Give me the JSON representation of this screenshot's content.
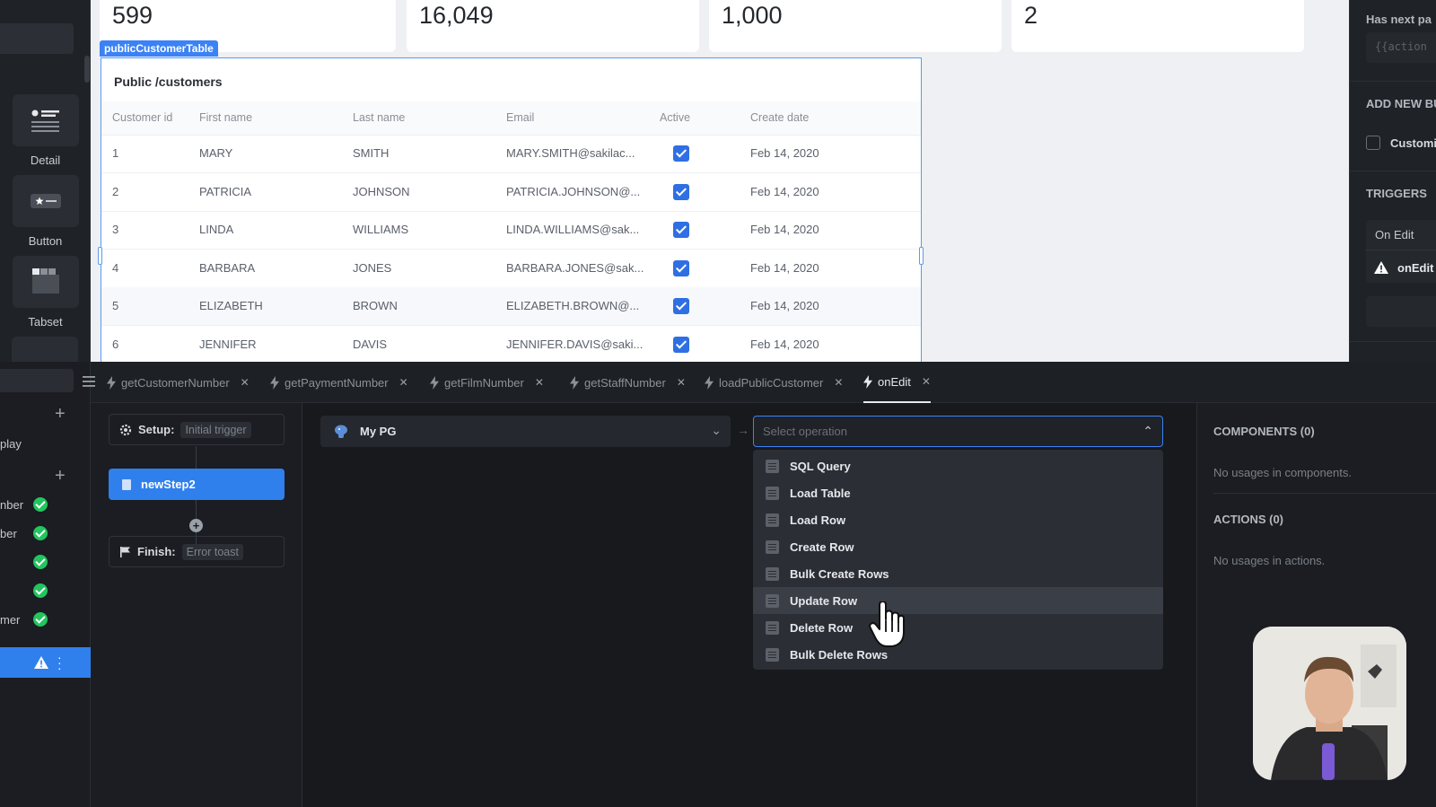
{
  "left_palette": {
    "components": [
      {
        "label": "Detail",
        "icon": "detail-icon"
      },
      {
        "label": "Button",
        "icon": "button-icon"
      },
      {
        "label": "Tabset",
        "icon": "tabset-icon"
      }
    ]
  },
  "stats": [
    "599",
    "16,049",
    "1,000",
    "2"
  ],
  "table": {
    "tag": "publicCustomerTable",
    "title": "Public /customers",
    "columns": [
      "Customer id",
      "First name",
      "Last name",
      "Email",
      "Active",
      "Create date"
    ],
    "rows": [
      {
        "id": "1",
        "first": "MARY",
        "last": "SMITH",
        "email": "MARY.SMITH@sakilac...",
        "active": true,
        "date": "Feb 14, 2020"
      },
      {
        "id": "2",
        "first": "PATRICIA",
        "last": "JOHNSON",
        "email": "PATRICIA.JOHNSON@...",
        "active": true,
        "date": "Feb 14, 2020"
      },
      {
        "id": "3",
        "first": "LINDA",
        "last": "WILLIAMS",
        "email": "LINDA.WILLIAMS@sak...",
        "active": true,
        "date": "Feb 14, 2020"
      },
      {
        "id": "4",
        "first": "BARBARA",
        "last": "JONES",
        "email": "BARBARA.JONES@sak...",
        "active": true,
        "date": "Feb 14, 2020"
      },
      {
        "id": "5",
        "first": "ELIZABETH",
        "last": "BROWN",
        "email": "ELIZABETH.BROWN@...",
        "active": true,
        "date": "Feb 14, 2020"
      },
      {
        "id": "6",
        "first": "JENNIFER",
        "last": "DAVIS",
        "email": "JENNIFER.DAVIS@saki...",
        "active": true,
        "date": "Feb 14, 2020"
      }
    ]
  },
  "inspector": {
    "has_next_page_label": "Has next pa",
    "has_next_page_value": "{{action",
    "add_new_label": "ADD NEW BU",
    "custom_label": "Customi",
    "triggers_label": "TRIGGERS",
    "on_edit_label": "On Edit",
    "on_edit_handler": "onEdit"
  },
  "query_sidebar": {
    "section_label": "play",
    "queries": [
      {
        "label": "nber",
        "status": "ok"
      },
      {
        "label": "ber",
        "status": "ok"
      },
      {
        "label": "",
        "status": "ok"
      },
      {
        "label": "",
        "status": "ok"
      },
      {
        "label": "mer",
        "status": "ok"
      }
    ]
  },
  "tabs": [
    {
      "label": "getCustomerNumber",
      "active": false
    },
    {
      "label": "getPaymentNumber",
      "active": false
    },
    {
      "label": "getFilmNumber",
      "active": false
    },
    {
      "label": "getStaffNumber",
      "active": false
    },
    {
      "label": "loadPublicCustomer",
      "active": false
    },
    {
      "label": "onEdit",
      "active": true
    }
  ],
  "flow": {
    "setup_label": "Setup:",
    "setup_value": "Initial trigger",
    "step_label": "newStep2",
    "finish_label": "Finish:",
    "finish_value": "Error toast"
  },
  "editor": {
    "datasource": "My PG",
    "operation_placeholder": "Select operation",
    "operations": [
      {
        "label": "SQL Query",
        "highlighted": false
      },
      {
        "label": "Load Table",
        "highlighted": false
      },
      {
        "label": "Load Row",
        "highlighted": false
      },
      {
        "label": "Create Row",
        "highlighted": false
      },
      {
        "label": "Bulk Create Rows",
        "highlighted": false
      },
      {
        "label": "Update Row",
        "highlighted": true
      },
      {
        "label": "Delete Row",
        "highlighted": false
      },
      {
        "label": "Bulk Delete Rows",
        "highlighted": false
      }
    ]
  },
  "usages": {
    "components_label": "COMPONENTS (0)",
    "components_empty": "No usages in components.",
    "actions_label": "ACTIONS (0)",
    "actions_empty": "No usages in actions."
  },
  "colors": {
    "accent": "#2f80ed",
    "success": "#22c55e",
    "table_border": "#5b9bf0",
    "background": "#17191d"
  }
}
